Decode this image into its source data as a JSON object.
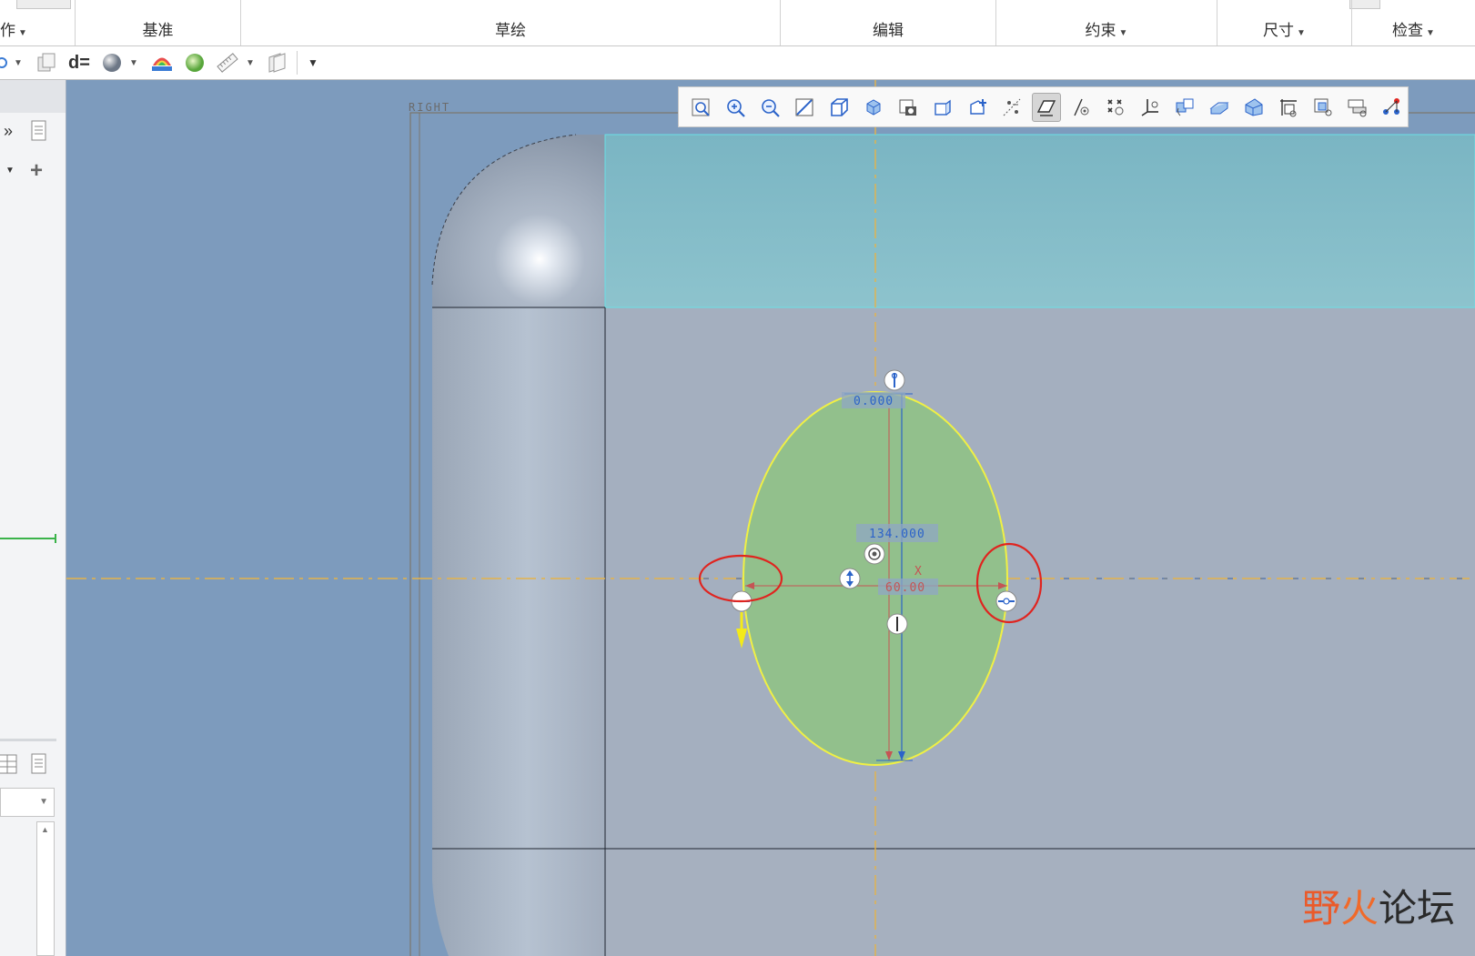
{
  "ribbon": {
    "groups": [
      {
        "label": "作",
        "has_arrow": true
      },
      {
        "label": "基准",
        "has_arrow": false
      },
      {
        "label": "草绘",
        "has_arrow": false
      },
      {
        "label": "编辑",
        "has_arrow": false
      },
      {
        "label": "约束",
        "has_arrow": true
      },
      {
        "label": "尺寸",
        "has_arrow": true
      },
      {
        "label": "检查",
        "has_arrow": true
      }
    ]
  },
  "toolbar2": {
    "d_equals_label": "d="
  },
  "leftpanel": {
    "expand_glyph": "»",
    "add_glyph": "+"
  },
  "graphics": {
    "plane_label": "RIGHT",
    "dim_top": "0.000",
    "dim_height": "134.000",
    "dim_width": "60.00",
    "axis_x_label": "X",
    "colors": {
      "background": "#7d9bbd",
      "part": "#a4afbf",
      "selected_face": "#86bcc6",
      "ellipse_fill": "#92c08c",
      "ellipse_stroke": "#f0f044",
      "centerline": "#e5b34a",
      "highlight_circle": "#e0241f"
    }
  },
  "viewbar": {
    "icons": [
      "refit-icon",
      "zoom-in-icon",
      "zoom-out-icon",
      "repaint-icon",
      "saved-orientations-icon",
      "view-manager-icon",
      "display-style-icon",
      "perspective-icon",
      "annotation-display-icon",
      "sketch-view-icon",
      "sketcher-display-icon",
      "datum-axis-display-icon",
      "datum-point-display-icon",
      "csys-display-icon",
      "spin-center-icon",
      "plane-display-icon",
      "point-tag-icon",
      "dimension-display-icon",
      "constraint-display-icon",
      "grid-display-icon",
      "vertex-display-icon"
    ],
    "active_index": 10
  },
  "watermark": {
    "part1": "野",
    "part2": "火",
    "part3": "论坛"
  }
}
